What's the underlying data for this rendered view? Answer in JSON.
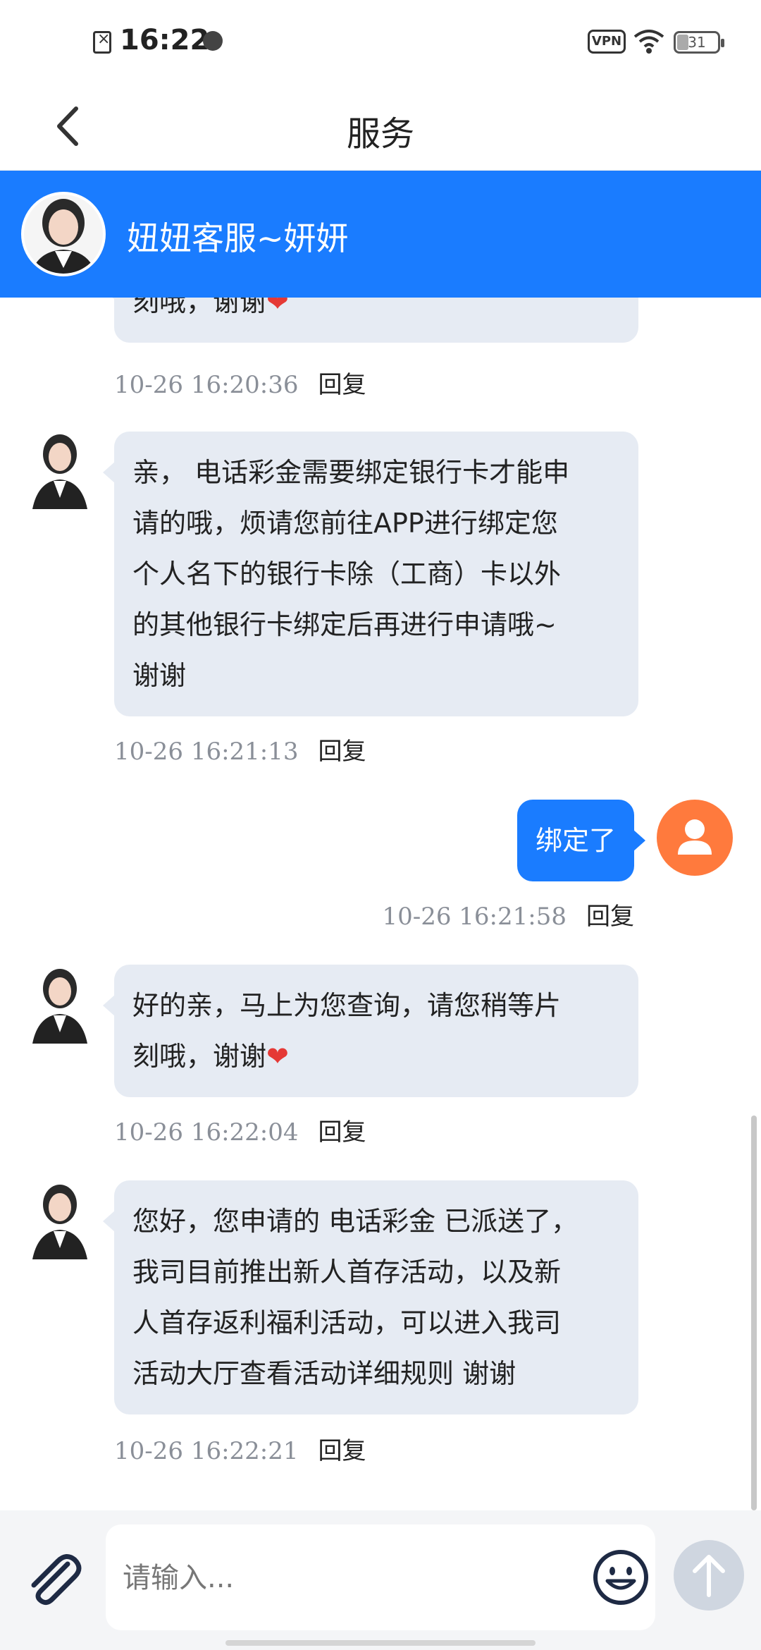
{
  "status_bar": {
    "time": "16:22",
    "vpn": "VPN",
    "battery": "31",
    "icons": [
      "file-x-icon",
      "bug-icon",
      "vpn-icon",
      "wifi-icon",
      "battery-icon"
    ]
  },
  "nav": {
    "title": "服务",
    "back_icon": "chevron-left-icon"
  },
  "agent": {
    "name": "妞妞客服~妍妍"
  },
  "messages": [
    {
      "direction": "in",
      "partial": true,
      "text": "刻哦，谢谢",
      "heart": "❤",
      "time": "10-26 16:20:36",
      "reply": "回复"
    },
    {
      "direction": "in",
      "lines": [
        "亲， 电话彩金需要绑定银行卡才能申",
        "请的哦，烦请您前往APP进行绑定您",
        "个人名下的银行卡除（工商）卡以外",
        "的其他银行卡绑定后再进行申请哦~",
        "谢谢"
      ],
      "time": "10-26 16:21:13",
      "reply": "回复"
    },
    {
      "direction": "out",
      "text": "绑定了",
      "time": "10-26 16:21:58",
      "reply": "回复"
    },
    {
      "direction": "in",
      "lines": [
        "好的亲，马上为您查询，请您稍等片",
        "刻哦，谢谢"
      ],
      "heart": "❤",
      "time": "10-26 16:22:04",
      "reply": "回复"
    },
    {
      "direction": "in",
      "lines": [
        "您好，您申请的 电话彩金 已派送了，",
        "我司目前推出新人首存活动，以及新",
        "人首存返利福利活动，可以进入我司",
        "活动大厅查看活动详细规则 谢谢"
      ],
      "time": "10-26 16:22:21",
      "reply": "回复"
    }
  ],
  "input": {
    "placeholder": "请输入...",
    "attach_icon": "paperclip-icon",
    "emoji_icon": "smiley-icon",
    "send_icon": "arrow-up-icon"
  },
  "colors": {
    "accent": "#1a7cff",
    "bubble_in": "#e6ebf3",
    "user_avatar": "#ff7a3d",
    "heart": "#e53935"
  }
}
